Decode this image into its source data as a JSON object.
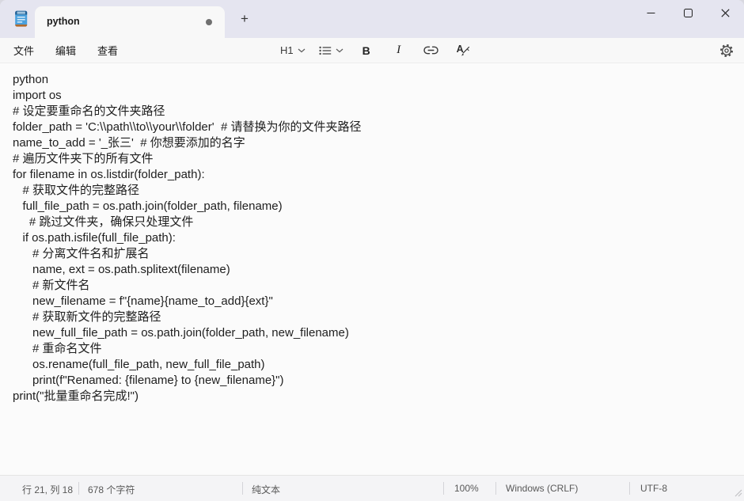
{
  "titlebar": {
    "tab_title": "python",
    "new_tab_button": "+"
  },
  "menubar": {
    "items": [
      {
        "label": "文件"
      },
      {
        "label": "编辑"
      },
      {
        "label": "查看"
      }
    ]
  },
  "toolbar": {
    "heading_label": "H1",
    "bold_label": "B",
    "italic_label": "I",
    "clear_format_letter": "A"
  },
  "editor": {
    "lines": [
      "python",
      "import os",
      "# 设定要重命名的文件夹路径",
      "folder_path = 'C:\\\\path\\\\to\\\\your\\\\folder'  # 请替换为你的文件夹路径",
      "name_to_add = '_张三'  # 你想要添加的名字",
      "# 遍历文件夹下的所有文件",
      "for filename in os.listdir(folder_path):",
      "   # 获取文件的完整路径",
      "   full_file_path = os.path.join(folder_path, filename)",
      "     # 跳过文件夹，确保只处理文件",
      "   if os.path.isfile(full_file_path):",
      "      # 分离文件名和扩展名",
      "      name, ext = os.path.splitext(filename)",
      "      # 新文件名",
      "      new_filename = f\"{name}{name_to_add}{ext}\"",
      "      # 获取新文件的完整路径",
      "      new_full_file_path = os.path.join(folder_path, new_filename)",
      "      # 重命名文件",
      "      os.rename(full_file_path, new_full_file_path)",
      "      print(f\"Renamed: {filename} to {new_filename}\")",
      "print(\"批量重命名完成!\")"
    ]
  },
  "statusbar": {
    "cursor_position": "行 21, 列 18",
    "character_count": "678 个字符",
    "document_type": "纯文本",
    "zoom_level": "100%",
    "line_endings": "Windows (CRLF)",
    "encoding": "UTF-8"
  },
  "icons": {
    "app": "notepad-icon",
    "tab_unsaved": "unsaved-dot-icon",
    "heading_dropdown": "chevron-down-icon",
    "list": "bullet-list-icon",
    "list_dropdown": "chevron-down-icon",
    "link": "link-icon",
    "clear_format": "clear-formatting-icon",
    "settings": "gear-icon",
    "minimize": "minimize-icon",
    "maximize": "maximize-icon",
    "close": "close-icon"
  },
  "colors": {
    "titlebar_bg": "#e5e5f0",
    "surface_bg": "#f8f8f8",
    "editor_bg": "#fbfbfb",
    "statusbar_bg": "#f4f4f6",
    "text": "#202020",
    "muted_text": "#585858",
    "app_icon_blue": "#4aa0dc"
  }
}
